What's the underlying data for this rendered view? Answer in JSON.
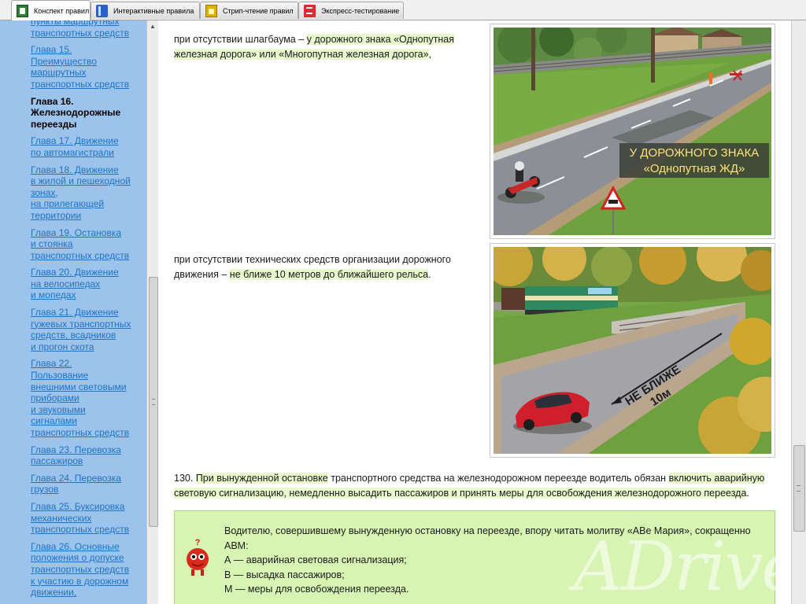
{
  "tabs": [
    {
      "label": "Конспект правил",
      "icon": "konspekt-icon",
      "active": true
    },
    {
      "label": "Интерактивные правила",
      "icon": "interactive-rules-icon",
      "active": false
    },
    {
      "label": "Стрип-чтение правил",
      "icon": "strip-reading-icon",
      "active": false
    },
    {
      "label": "Экспресс-тестирование",
      "icon": "express-test-icon",
      "active": false
    }
  ],
  "sidebar": {
    "items": [
      {
        "label": "пункты маршрутных\nтранспортных средств",
        "current": false
      },
      {
        "label": "Глава 15.\nПреимущество\nмаршрутных\nтранспортных средств",
        "current": false
      },
      {
        "label": "Глава 16.\nЖелезнодорожные\nпереезды",
        "current": true
      },
      {
        "label": "Глава 17. Движение\nпо автомагистрали",
        "current": false
      },
      {
        "label": "Глава 18. Движение\nв жилой и пешеходной\nзонах,\nна прилегающей\nтерритории",
        "current": false
      },
      {
        "label": "Глава 19. Остановка\nи стоянка\nтранспортных средств",
        "current": false
      },
      {
        "label": "Глава 20. Движение\nна велосипедах\nи мопедах",
        "current": false
      },
      {
        "label": "Глава 21. Движение\nгужевых транспортных\nсредств, всадников\nи прогон скота",
        "current": false
      },
      {
        "label": "Глава 22.\nПользование\nвнешними световыми\nприборами\nи звуковыми\nсигналами\nтранспортных средств",
        "current": false
      },
      {
        "label": "Глава 23. Перевозка\nпассажиров",
        "current": false
      },
      {
        "label": "Глава 24. Перевозка\nгрузов",
        "current": false
      },
      {
        "label": "Глава 25. Буксировка\nмеханических\nтранспортных средств",
        "current": false
      },
      {
        "label": "Глава 26. Основные\nположения о допуске\nтранспортных средств\nк участию в дорожном\nдвижении,",
        "current": false
      }
    ]
  },
  "content": {
    "p1": {
      "plain": "при отсутствии шлагбаума – ",
      "highlight": "у дорожного знака «Однопутная железная дорога» или «Многопутная железная дорога»",
      "tail": ","
    },
    "figure1": {
      "caption_line1": "У ДОРОЖНОГО ЗНАКА",
      "caption_line2": "«Однопутная ЖД»"
    },
    "p2": {
      "plain": "при отсутствии технических средств организации дорожного движения – ",
      "highlight": "не ближе 10 метров до ближайшего рельса",
      "tail": "."
    },
    "figure2": {
      "road_text_line1": "НЕ БЛИЖЕ",
      "road_text_line2": "10м"
    },
    "p3": {
      "number": "130. ",
      "hl1": "При вынужденной остановке",
      "mid": " транспортного средства на железнодорожном переезде водитель обязан ",
      "hl2": "включить аварийную световую сигнализацию, немедленно высадить пассажиров и принять меры для освобождения железнодорожного переезда",
      "tail": "."
    },
    "note": {
      "line1": "Водителю, совершившему вынужденную остановку на переезде, впору читать молитву «АВе Мария», сокращенно АВМ:",
      "line2": "А — аварийная световая сигнализация;",
      "line3": "В — высадка пассажиров;",
      "line4": "М — меры для освобождения переезда.",
      "mascot_symbol": "?",
      "watermark": "ADrive"
    }
  },
  "colors": {
    "sidebar_bg": "#9cc3eb",
    "link": "#1e73c7",
    "highlight": "#e6f8cc",
    "note_bg": "#d7f4b2"
  }
}
